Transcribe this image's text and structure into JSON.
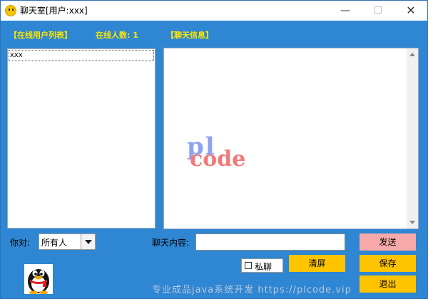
{
  "window": {
    "title": "聊天室[用户:xxx]",
    "minimize_glyph": "—",
    "maximize_glyph": "☐",
    "close_glyph": "✕"
  },
  "labels": {
    "online_users": "【在线用户列表】",
    "online_count_prefix": "在线人数:",
    "online_count": "1",
    "chat_info": "【聊天信息】",
    "to": "你对:",
    "chat_content": "聊天内容:"
  },
  "online_users": [
    "xxx"
  ],
  "recipient_select": {
    "value": "所有人"
  },
  "message_input": {
    "value": ""
  },
  "private_chat": {
    "label": "私聊",
    "checked": false
  },
  "buttons": {
    "send": "发送",
    "clear": "清屏",
    "save": "保存",
    "exit": "退出"
  },
  "watermark": {
    "top": "pl",
    "bottom": "code"
  },
  "footer_watermark": "专业成品java系统开发 https://plcode.vip",
  "icons": {
    "app": "smiley-icon",
    "avatar": "qq-penguin-icon"
  },
  "colors": {
    "window_bg": "#2f86d2",
    "label_yellow": "#ffe600",
    "send_button": "#f7a9a9",
    "action_button": "#ffc400"
  }
}
